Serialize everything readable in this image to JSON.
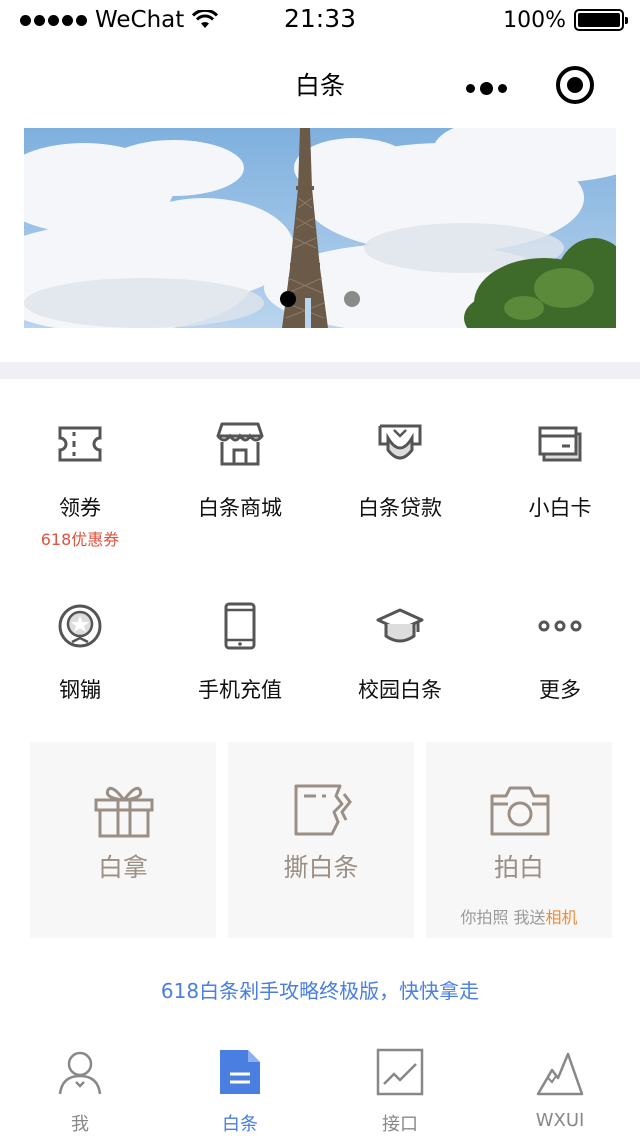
{
  "status_bar": {
    "carrier": "WeChat",
    "time": "21:33",
    "battery": "100%",
    "battery_level": 1.0
  },
  "nav": {
    "title": "白条"
  },
  "banner": {
    "pages": 2,
    "active_page": 1
  },
  "grid_row1": [
    {
      "label": "领券",
      "sub": "618优惠券",
      "icon": "ticket-icon"
    },
    {
      "label": "白条商城",
      "sub": "",
      "icon": "store-icon"
    },
    {
      "label": "白条贷款",
      "sub": "",
      "icon": "loan-icon"
    },
    {
      "label": "小白卡",
      "sub": "",
      "icon": "card-icon"
    }
  ],
  "grid_row2": [
    {
      "label": "钢镚",
      "icon": "coin-icon"
    },
    {
      "label": "手机充值",
      "icon": "phone-icon"
    },
    {
      "label": "校园白条",
      "icon": "graduation-cap-icon"
    },
    {
      "label": "更多",
      "icon": "more-icon"
    }
  ],
  "cards": [
    {
      "label": "白拿",
      "icon": "gift-icon"
    },
    {
      "label": "撕白条",
      "icon": "tear-note-icon"
    },
    {
      "label": "拍白",
      "icon": "camera-icon",
      "sub_prefix": "你拍照 我送",
      "sub_highlight": "相机"
    }
  ],
  "promo": "618白条剁手攻略终极版，快快拿走",
  "tabs": [
    {
      "label": "我",
      "icon": "user-icon",
      "active": false
    },
    {
      "label": "白条",
      "icon": "document-icon",
      "active": true
    },
    {
      "label": "接口",
      "icon": "chart-icon",
      "active": false
    },
    {
      "label": "WXUI",
      "icon": "mountain-icon",
      "active": false
    }
  ],
  "colors": {
    "accent": "#4a7ee0",
    "coupon_red": "#e0533f",
    "highlight_orange": "#f08c3a",
    "card_text": "#9b8f85",
    "separator": "#efeff4"
  }
}
